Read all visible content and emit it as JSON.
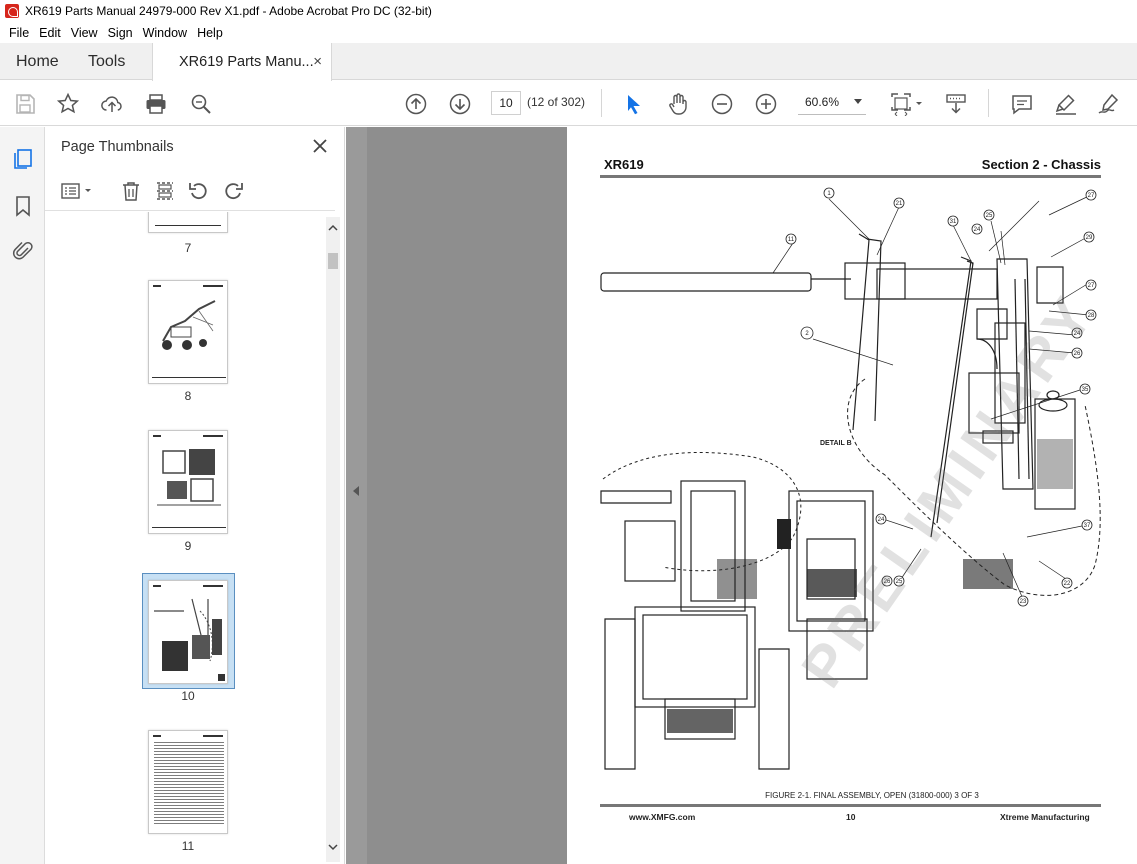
{
  "window": {
    "title": "XR619 Parts Manual 24979-000 Rev X1.pdf - Adobe Acrobat Pro DC (32-bit)"
  },
  "menu": [
    "File",
    "Edit",
    "View",
    "Sign",
    "Window",
    "Help"
  ],
  "tabs": {
    "home": "Home",
    "tools": "Tools",
    "document": "XR619 Parts Manu...",
    "close_symbol": "×"
  },
  "toolbar": {
    "page_number": "10",
    "page_of": "(12 of 302)",
    "zoom": "60.6%",
    "icons": [
      "save-icon",
      "bookmark-star-icon",
      "upload-icon",
      "print-icon",
      "zoom-search-icon",
      "prev-page-icon",
      "next-page-icon",
      "select-cursor-icon",
      "hand-icon",
      "zoom-out-icon",
      "zoom-in-icon",
      "fit-page-icon",
      "scroll-mode-icon",
      "comment-icon",
      "highlight-icon",
      "sign-icon"
    ]
  },
  "thumbnail_panel": {
    "title": "Page Thumbnails",
    "thumbnails": [
      {
        "label": "7"
      },
      {
        "label": "8"
      },
      {
        "label": "9"
      },
      {
        "label": "10",
        "selected": true
      },
      {
        "label": "11"
      }
    ]
  },
  "document_page": {
    "header_left": "XR619",
    "header_right": "Section 2 - Chassis",
    "detail_label": "DETAIL B",
    "figure_caption": "FIGURE 2-1.  FINAL ASSEMBLY, OPEN  (31800-000) 3 OF 3",
    "footer_left": "www.XMFG.com",
    "footer_center": "10",
    "footer_right": "Xtreme Manufacturing",
    "watermark": "PRELIMINARY",
    "callouts": [
      "1",
      "21",
      "27",
      "31",
      "25",
      "24",
      "29",
      "11",
      "27",
      "28",
      "2",
      "24",
      "26",
      "35",
      "24",
      "37",
      "26",
      "25",
      "23",
      "22"
    ]
  },
  "colors": {
    "acrobat_red": "#d6261c",
    "select_blue": "#1473e6",
    "selection_bg": "#c7e0f4"
  }
}
